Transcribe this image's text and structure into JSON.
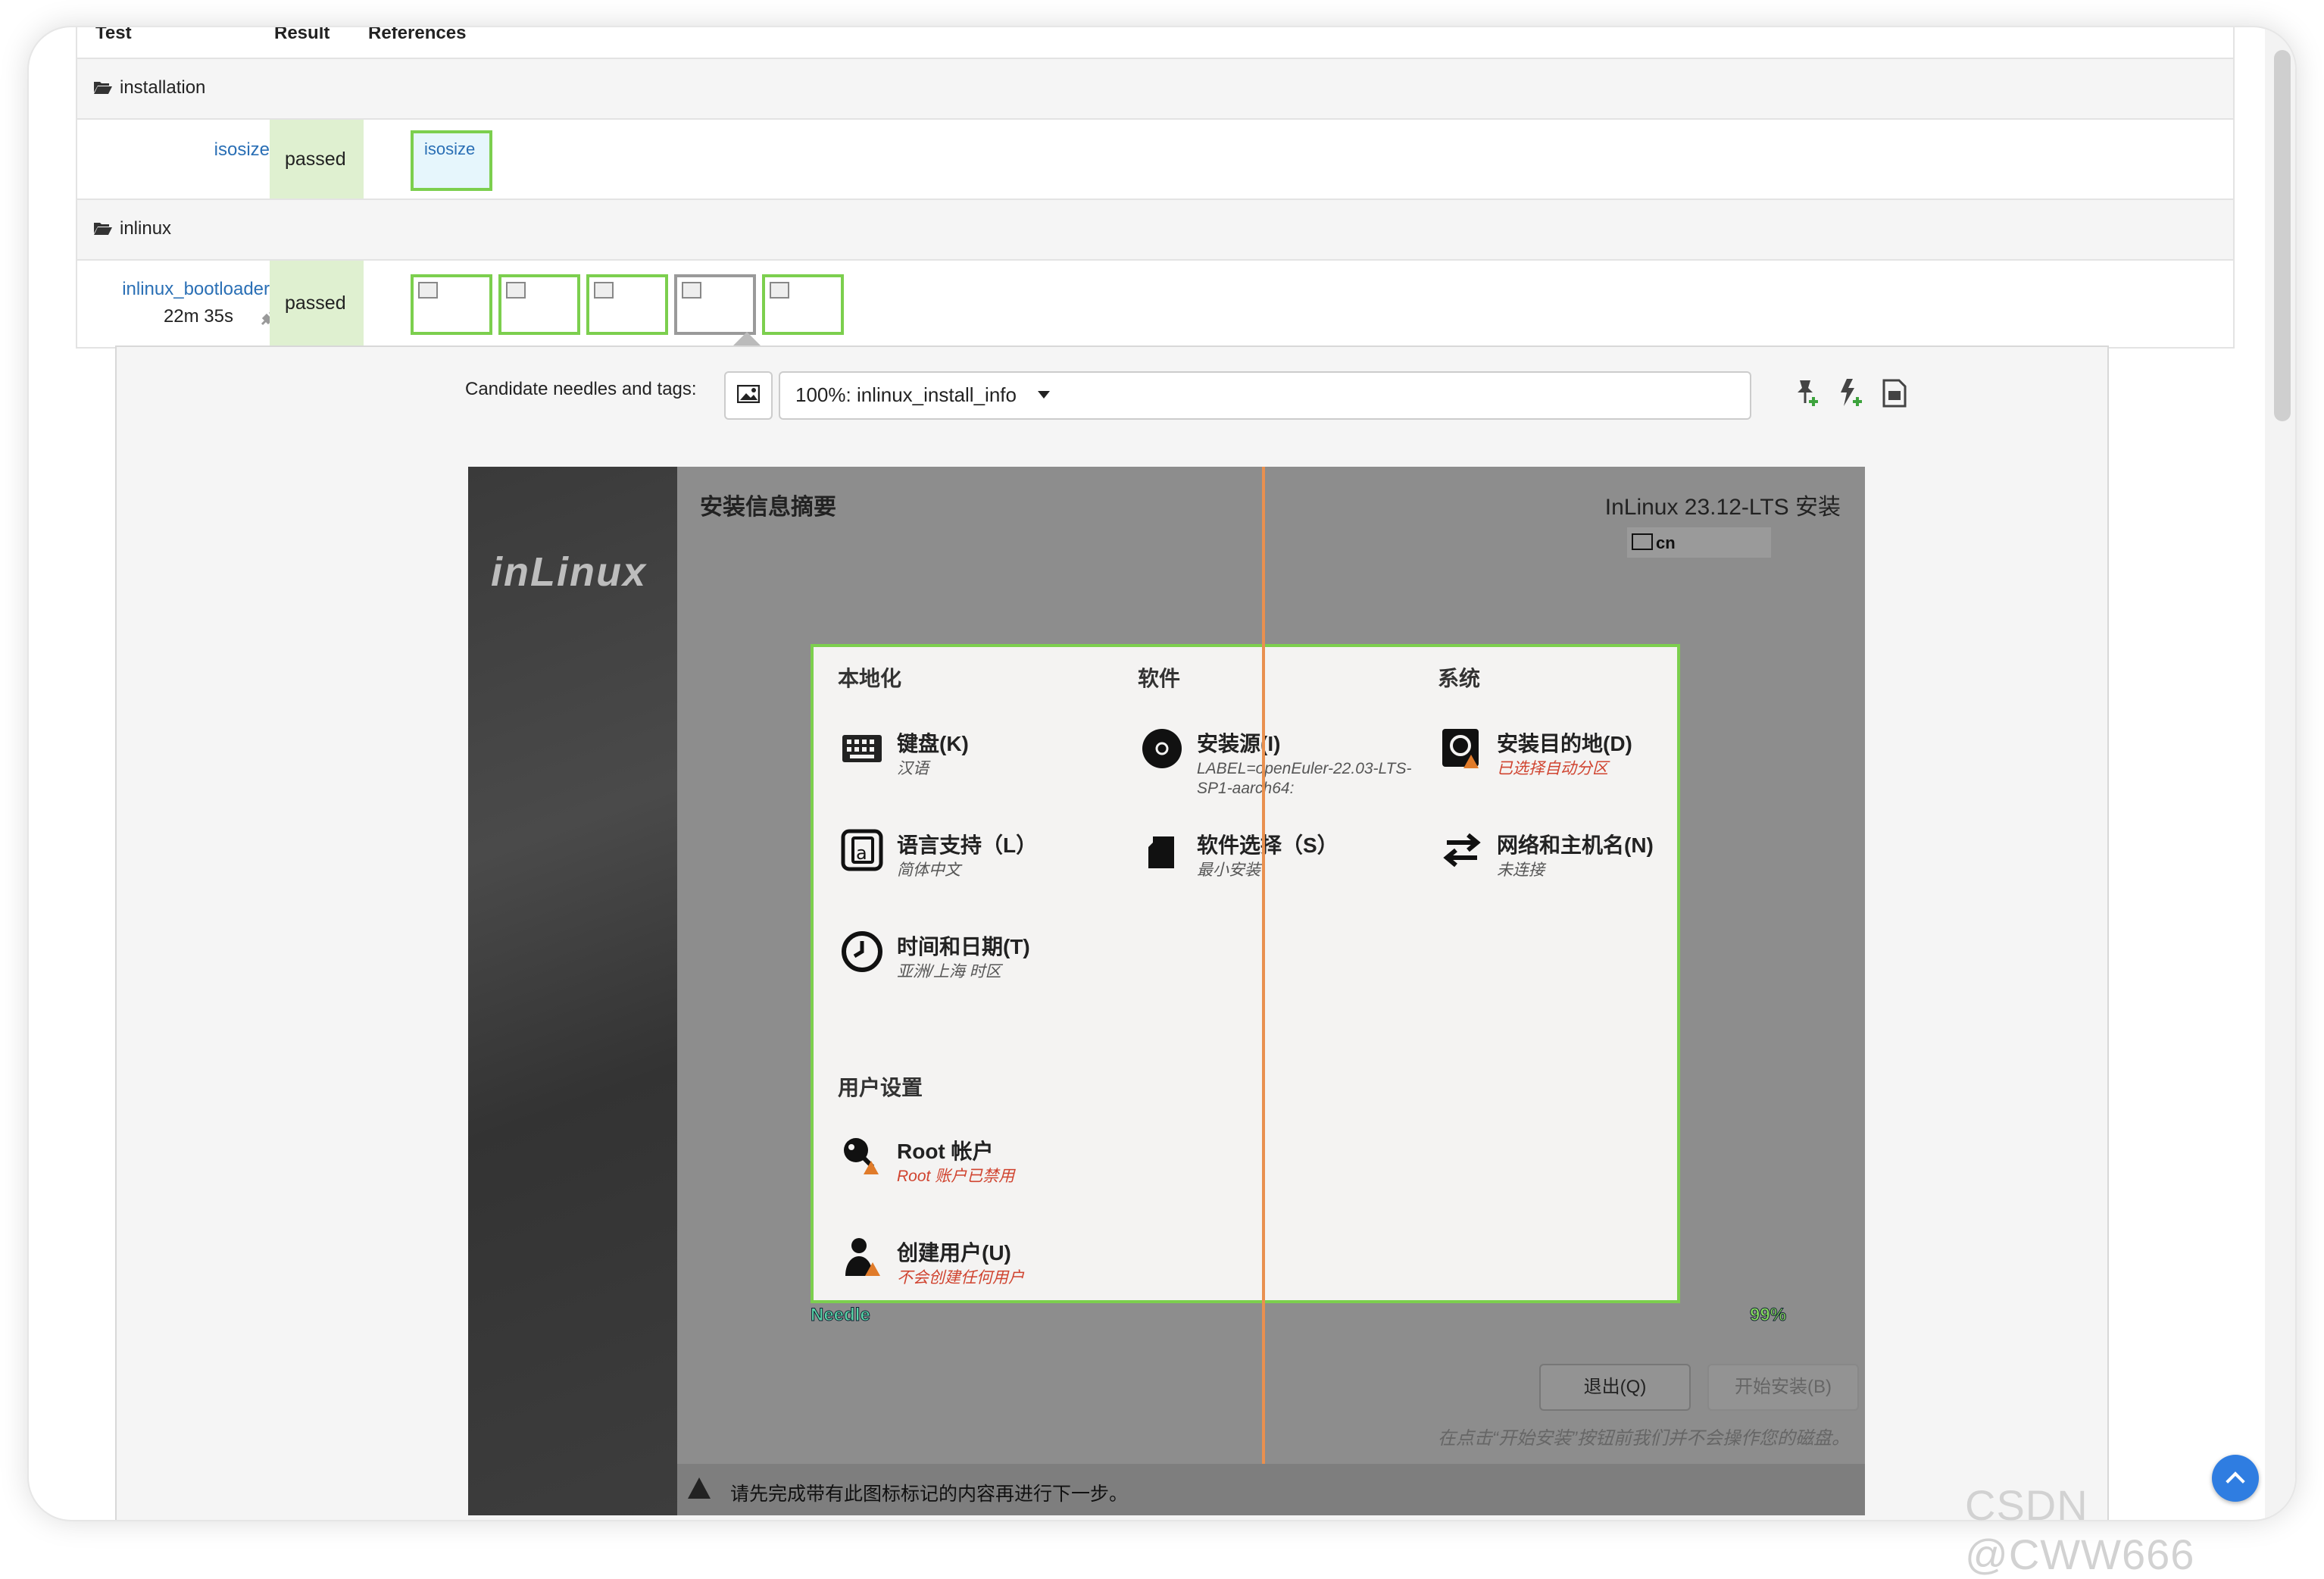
{
  "table": {
    "headers": {
      "test": "Test",
      "result": "Result",
      "references": "References"
    },
    "categories": [
      {
        "name": "installation",
        "modules": [
          {
            "name": "isosize",
            "duration": "",
            "result": "passed",
            "references": [
              {
                "label": "isosize",
                "status": "ok"
              }
            ]
          }
        ]
      },
      {
        "name": "inlinux",
        "modules": [
          {
            "name": "inlinux_bootloader",
            "duration": "22m 35s",
            "result": "passed",
            "references": [
              {
                "label": "",
                "status": "ok"
              },
              {
                "label": "",
                "status": "ok"
              },
              {
                "label": "",
                "status": "ok"
              },
              {
                "label": "",
                "status": "neutral"
              },
              {
                "label": "",
                "status": "ok-selected"
              }
            ]
          }
        ]
      }
    ]
  },
  "needle_panel": {
    "candidate_label": "Candidate needles and tags:",
    "selected_needle": "100%: inlinux_install_info",
    "icons": [
      "image-icon",
      "pin-add-icon",
      "pin-flash-icon",
      "file-icon"
    ]
  },
  "screenshot": {
    "logo": "inLinux",
    "title": "安装信息摘要",
    "product": "InLinux 23.12-LTS 安装",
    "keyboard_layout": "cn",
    "columns": [
      "本地化",
      "软件",
      "系统"
    ],
    "spokes": [
      {
        "title": "键盘(K)",
        "status": "汉语",
        "warn": false,
        "icon": "keyboard-icon"
      },
      {
        "title": "安装源(I)",
        "status": "LABEL=openEuler-22.03-LTS-SP1-aarch64:",
        "warn": false,
        "icon": "disc-icon"
      },
      {
        "title": "安装目的地(D)",
        "status": "已选择自动分区",
        "warn": true,
        "icon": "disk-icon"
      },
      {
        "title": "语言支持（L）",
        "status": "简体中文",
        "warn": false,
        "icon": "language-icon"
      },
      {
        "title": "软件选择（S）",
        "status": "最小安装",
        "warn": false,
        "icon": "package-icon"
      },
      {
        "title": "网络和主机名(N)",
        "status": "未连接",
        "warn": false,
        "icon": "network-icon"
      },
      {
        "title": "时间和日期(T)",
        "status": "亚洲/上海 时区",
        "warn": false,
        "icon": "clock-icon"
      }
    ],
    "user_settings_title": "用户设置",
    "user_spokes": [
      {
        "title": "Root 帐户",
        "status": "Root 账户已禁用",
        "warn": true,
        "icon": "root-key-icon"
      },
      {
        "title": "创建用户(U)",
        "status": "不会创建任何用户",
        "warn": true,
        "icon": "user-icon"
      }
    ],
    "needle_tag": "Needle",
    "match_pct": "99%",
    "quit_button": "退出(Q)",
    "begin_button": "开始安装(B)",
    "hint": "在点击“开始安装”按钮前我们并不会操作您的磁盘。",
    "warning_bar": "请先完成带有此图标标记的内容再进行下一步。"
  },
  "watermark": "CSDN @CWW666",
  "colors": {
    "ok_border": "#7ccf4e",
    "passed_bg": "#dff0d0",
    "link": "#2a6fb5",
    "warn_text": "#d0432f",
    "needle_line": "#e9904f",
    "top_button": "#2f7de1"
  }
}
